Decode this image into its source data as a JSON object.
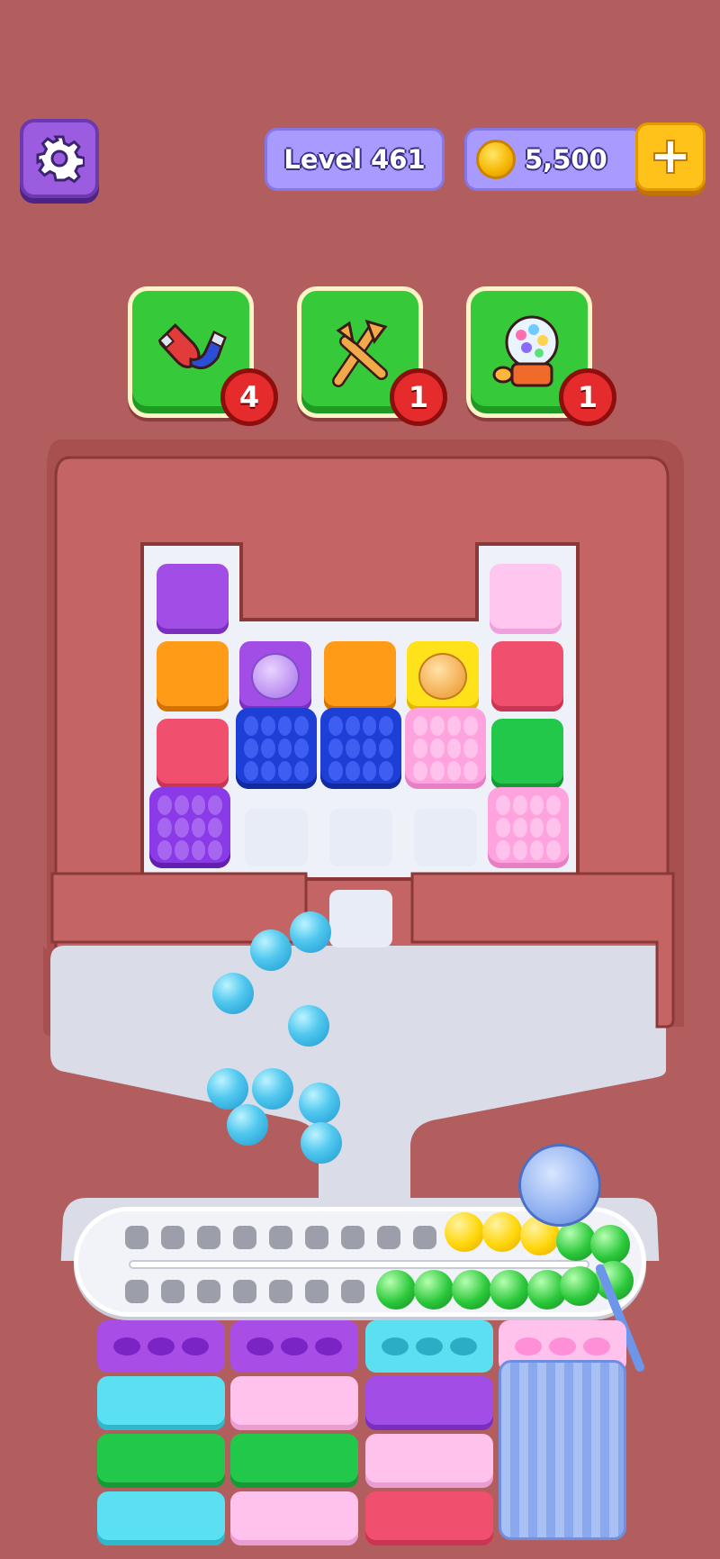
{
  "header": {
    "level_label": "Level 461",
    "coins": "5,500"
  },
  "boosters": [
    {
      "name": "magnet",
      "count": "4"
    },
    {
      "name": "shuffle",
      "count": "1"
    },
    {
      "name": "gumball-machine",
      "count": "1"
    }
  ],
  "colors": {
    "background": "#b35e5e",
    "booster_green": "#36c93a",
    "badge_red": "#e52b2b",
    "pill_purple": "#a89aff",
    "accent_yellow": "#ffc21a"
  },
  "icons": [
    "gear-icon",
    "coin-icon",
    "plus-icon",
    "magnet-icon",
    "shuffle-icon",
    "gumball-machine-icon",
    "yarn-ball-icon"
  ]
}
